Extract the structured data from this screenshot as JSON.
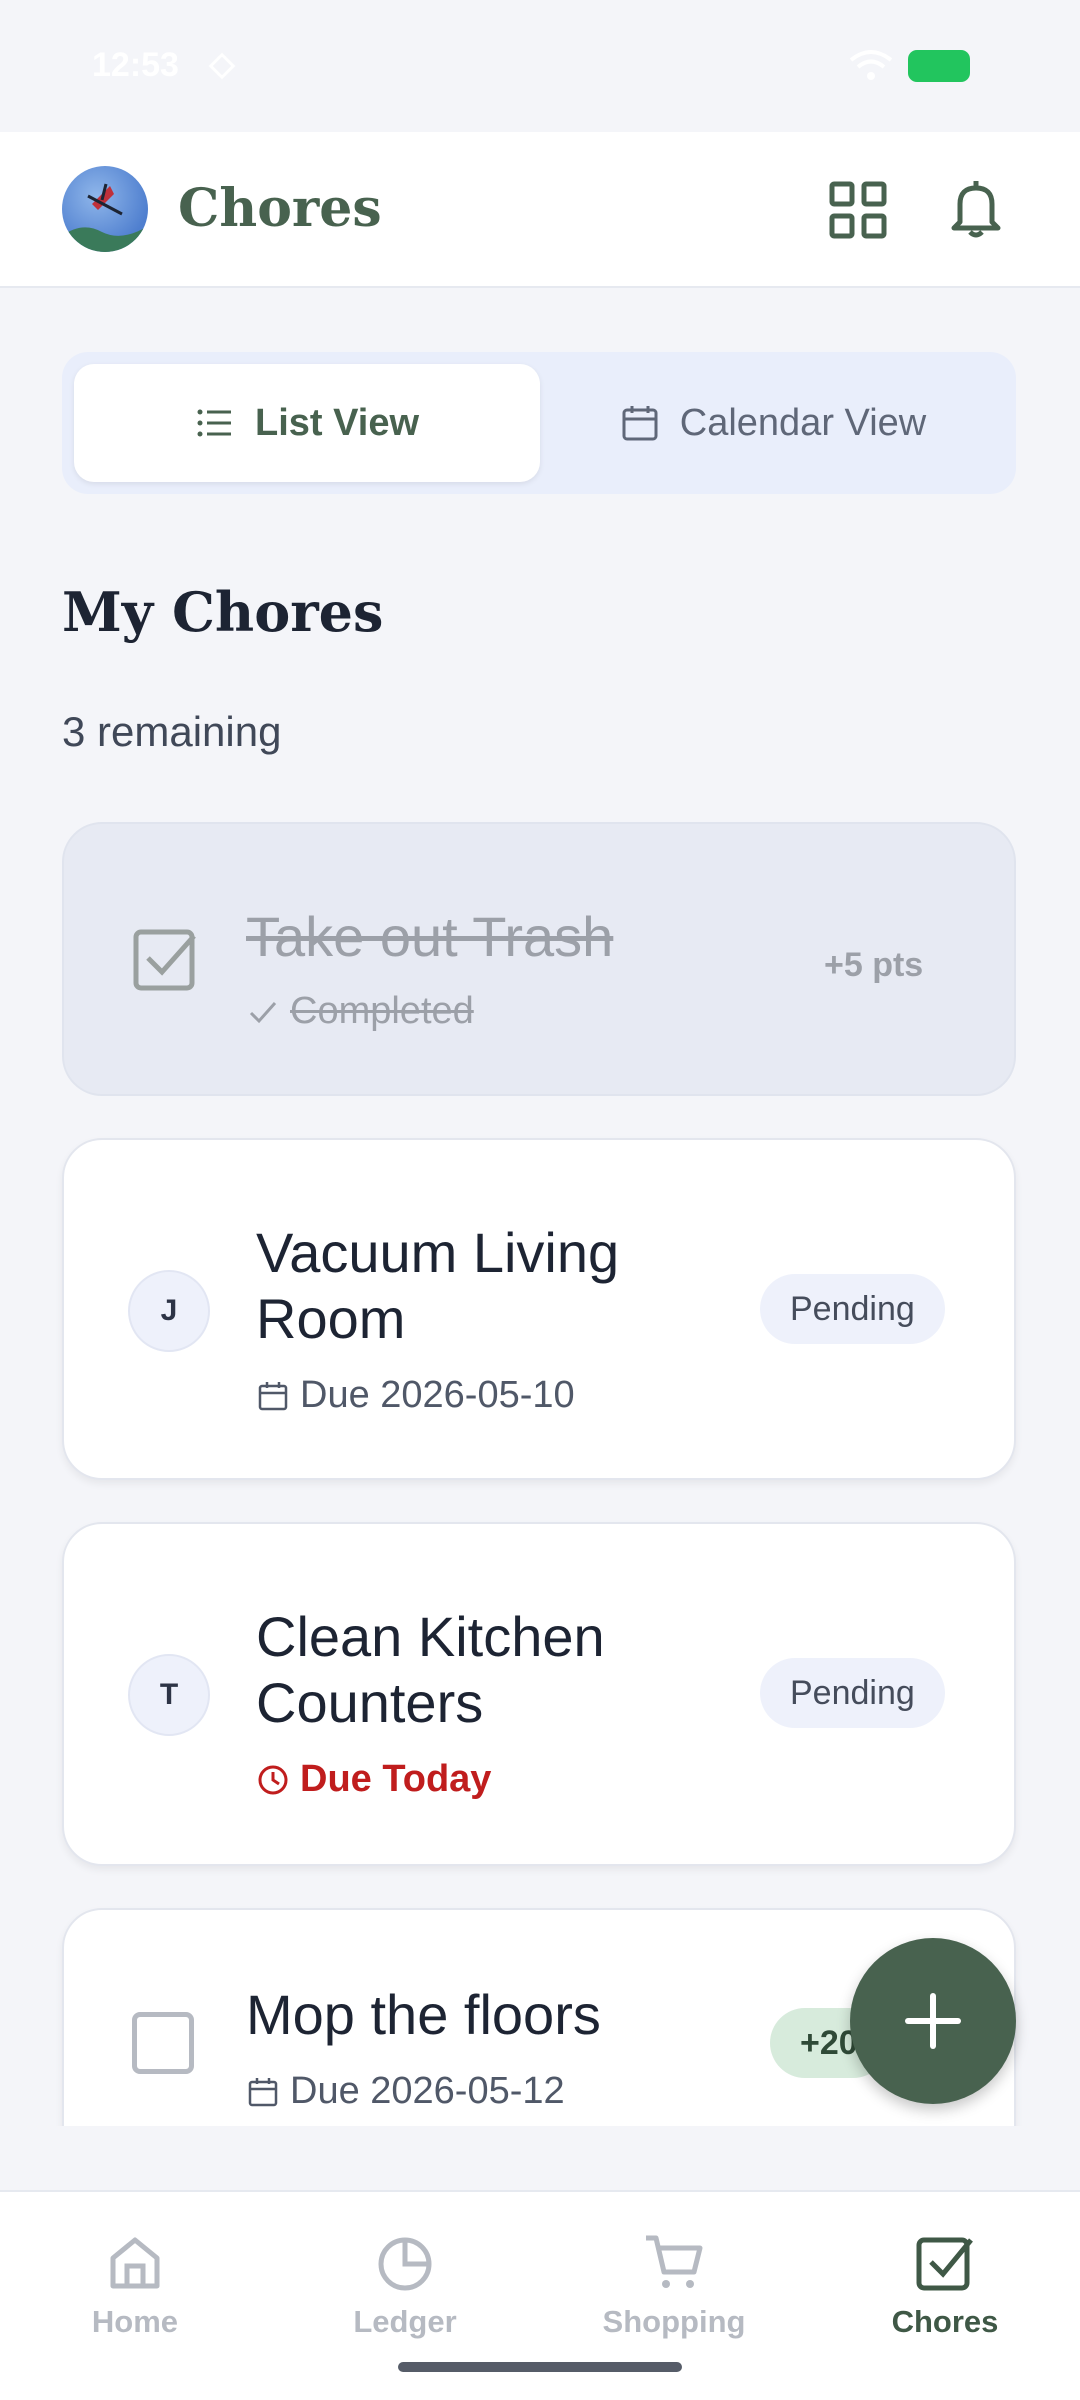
{
  "status_bar": {
    "time": "12:53"
  },
  "header": {
    "title": "Chores"
  },
  "view_toggle": {
    "list_label": "List View",
    "calendar_label": "Calendar View",
    "selected": "List View"
  },
  "section": {
    "title": "My Chores",
    "remaining": "3 remaining"
  },
  "chores": [
    {
      "title": "Take out Trash",
      "status": "Completed",
      "points": "+5 pts",
      "completed": true
    },
    {
      "title_line1": "Vacuum Living",
      "title_line2": "Room",
      "assignee": "J",
      "due": "Due 2026-05-10",
      "status": "Pending"
    },
    {
      "title_line1": "Clean Kitchen",
      "title_line2": "Counters",
      "assignee": "T",
      "due": "Due Today",
      "status": "Pending"
    },
    {
      "title": "Mop the floors",
      "due": "Due 2026-05-12",
      "points": "+20"
    }
  ],
  "nav": {
    "items": [
      {
        "label": "Home",
        "icon": "home-icon"
      },
      {
        "label": "Ledger",
        "icon": "pie-chart-icon"
      },
      {
        "label": "Shopping",
        "icon": "cart-icon"
      },
      {
        "label": "Chores",
        "icon": "checkbox-icon",
        "active": true
      }
    ]
  },
  "colors": {
    "brand": "#48624f",
    "danger": "#c01d1d",
    "background": "#f4f5f9"
  }
}
